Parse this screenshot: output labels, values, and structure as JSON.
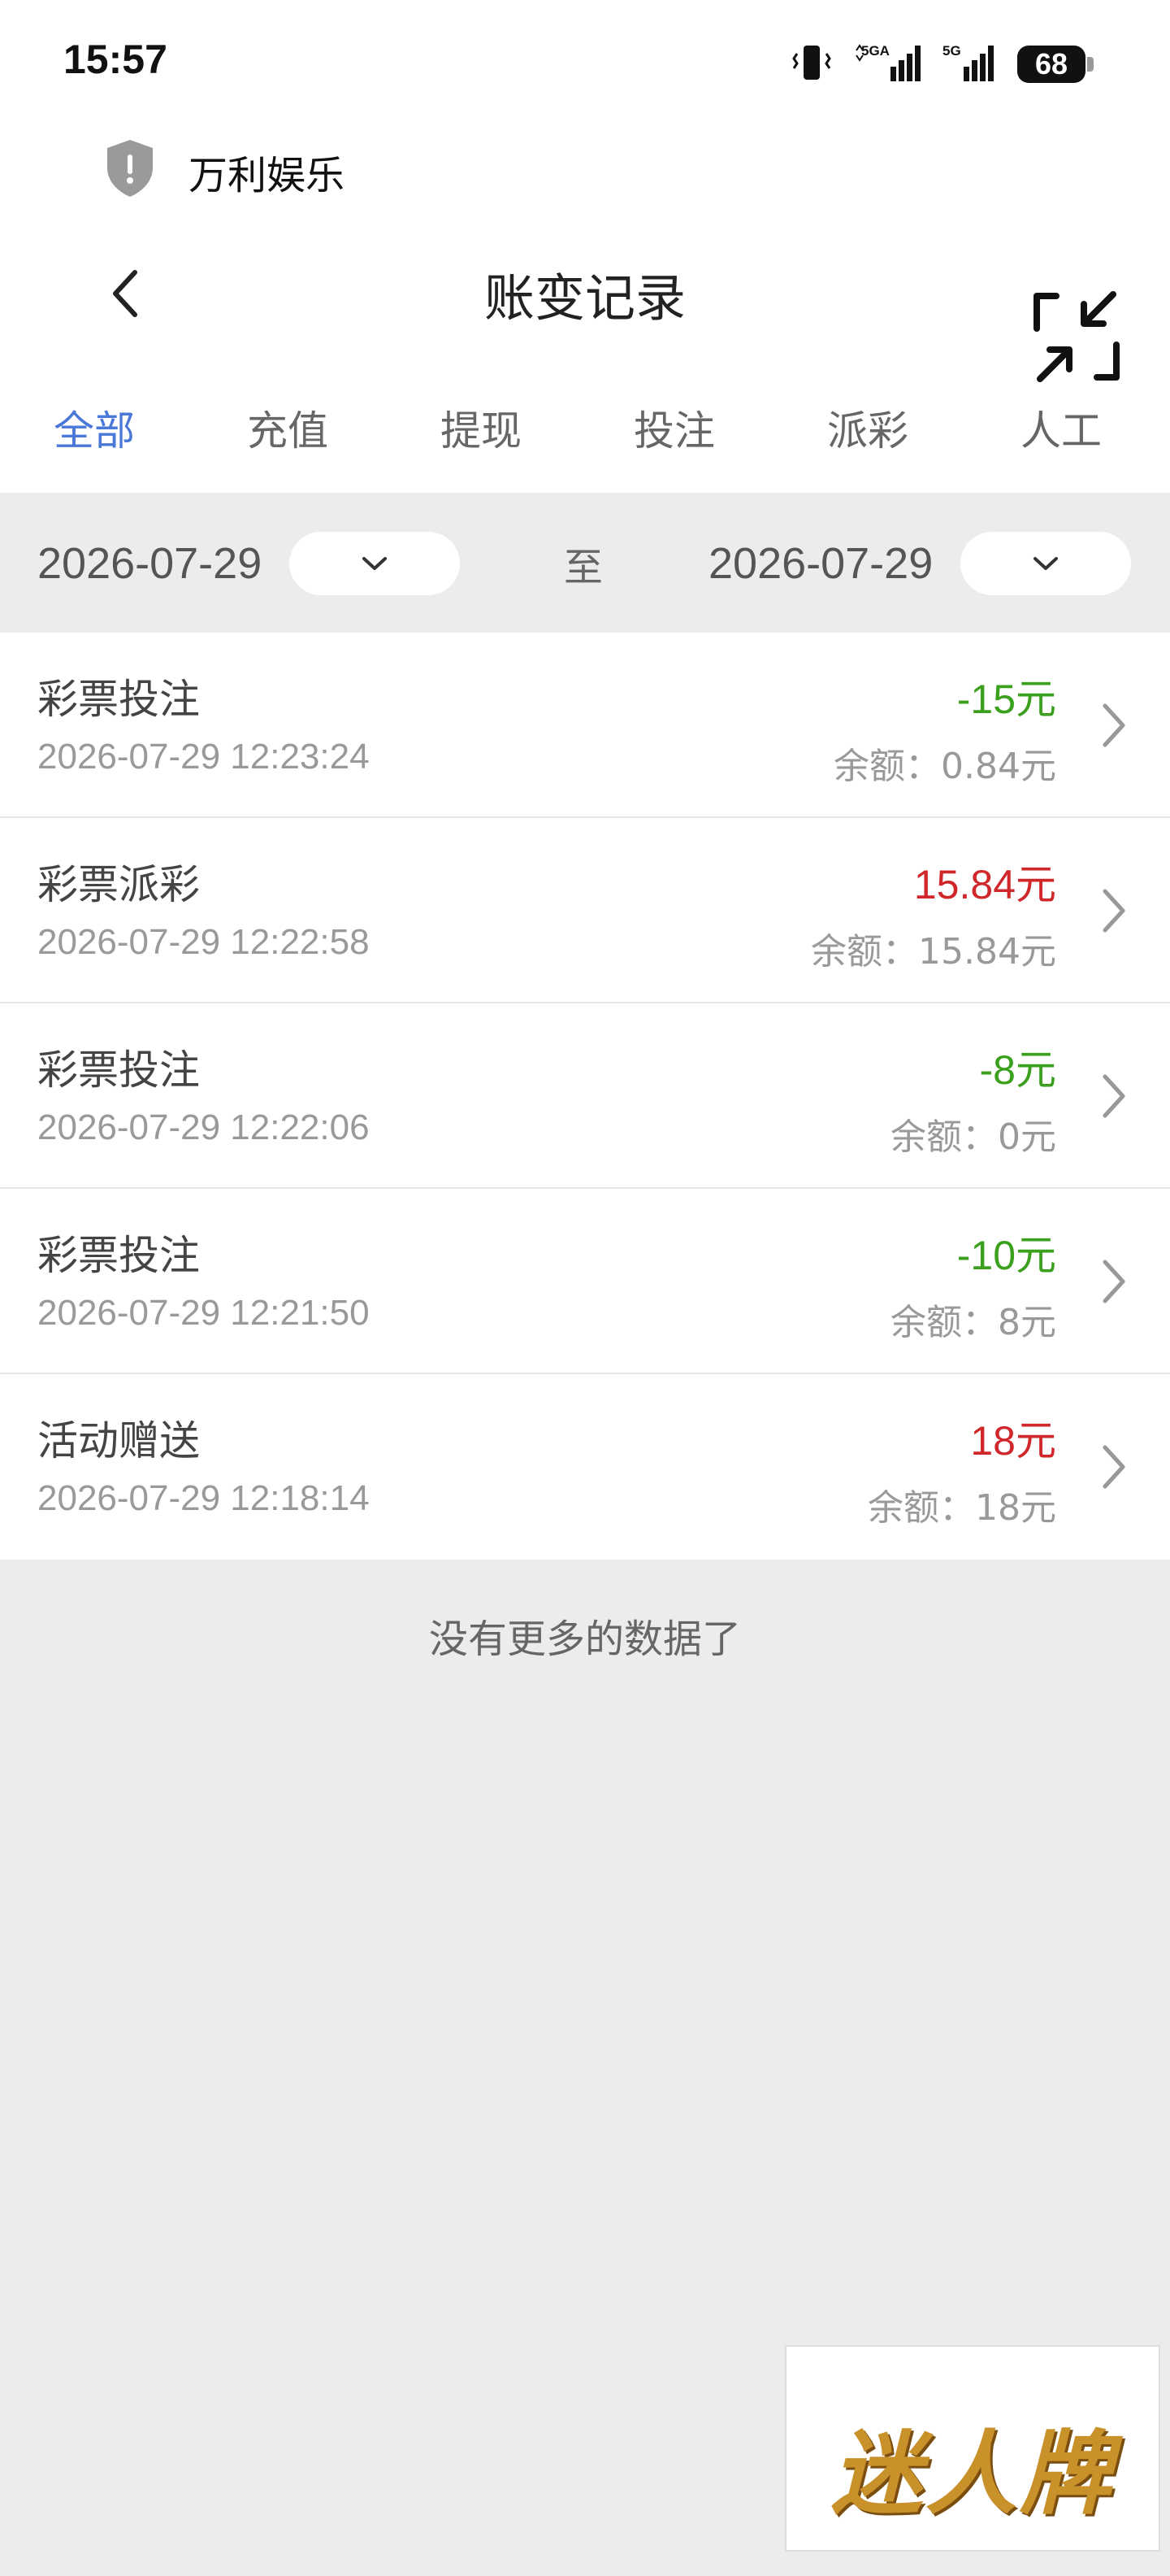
{
  "status_bar": {
    "time": "15:57",
    "battery": "68"
  },
  "site": {
    "title": "万利娱乐"
  },
  "header": {
    "title": "账变记录"
  },
  "tabs": [
    {
      "label": "全部",
      "active": true
    },
    {
      "label": "充值",
      "active": false
    },
    {
      "label": "提现",
      "active": false
    },
    {
      "label": "投注",
      "active": false
    },
    {
      "label": "派彩",
      "active": false
    },
    {
      "label": "人工",
      "active": false
    }
  ],
  "date_filter": {
    "start": "2026-07-29",
    "separator": "至",
    "end": "2026-07-29"
  },
  "records": [
    {
      "type": "彩票投注",
      "time": "2026-07-29 12:23:24",
      "amount": "-15元",
      "sign": "neg",
      "balance": "余额：0.84元"
    },
    {
      "type": "彩票派彩",
      "time": "2026-07-29 12:22:58",
      "amount": "15.84元",
      "sign": "pos",
      "balance": "余额：15.84元"
    },
    {
      "type": "彩票投注",
      "time": "2026-07-29 12:22:06",
      "amount": "-8元",
      "sign": "neg",
      "balance": "余额：0元"
    },
    {
      "type": "彩票投注",
      "time": "2026-07-29 12:21:50",
      "amount": "-10元",
      "sign": "neg",
      "balance": "余额：8元"
    },
    {
      "type": "活动赠送",
      "time": "2026-07-29 12:18:14",
      "amount": "18元",
      "sign": "pos",
      "balance": "余额：18元"
    }
  ],
  "footer": {
    "no_more": "没有更多的数据了"
  },
  "brand": {
    "logo_text": "迷人牌"
  },
  "colors": {
    "accent": "#4a78d8",
    "negative": "#3aa01d",
    "positive": "#d0272a"
  }
}
